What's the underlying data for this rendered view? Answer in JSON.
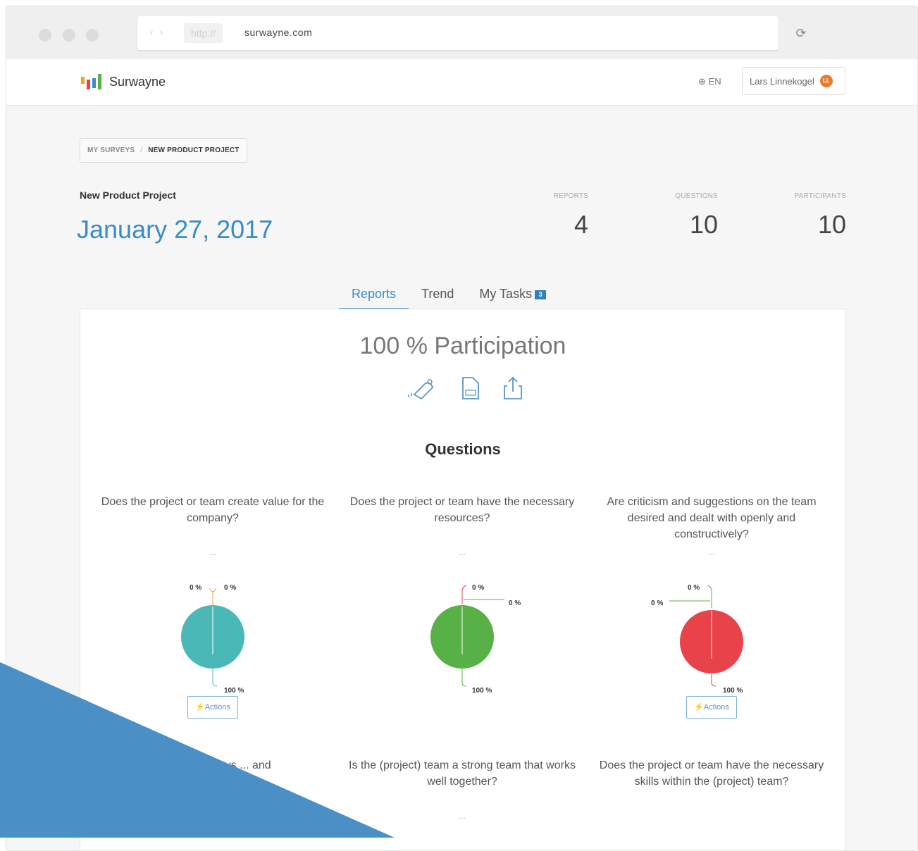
{
  "browser": {
    "url_scheme": "http://",
    "url_host": "surwayne.com",
    "nav_glyphs": "‹ ›",
    "reload_glyph": "⟳"
  },
  "header": {
    "brand": "Surwayne",
    "language": "EN",
    "user_name": "Lars Linnekogel",
    "user_initials": "LL"
  },
  "breadcrumb": {
    "root": "MY SURVEYS",
    "separator": "/",
    "current": "NEW PRODUCT PROJECT"
  },
  "project": {
    "name": "New Product Project",
    "date": "January 27, 2017"
  },
  "stats": [
    {
      "label": "REPORTS",
      "value": "4"
    },
    {
      "label": "QUESTIONS",
      "value": "10"
    },
    {
      "label": "PARTICIPANTS",
      "value": "10"
    }
  ],
  "tabs": [
    {
      "label": "Reports",
      "active": true
    },
    {
      "label": "Trend",
      "active": false
    },
    {
      "label": "My Tasks",
      "active": false,
      "badge": "3"
    }
  ],
  "report": {
    "participation": "100 % Participation",
    "icons": [
      "notify-bell-icon",
      "pdf-file-icon",
      "share-icon"
    ],
    "questions_title": "Questions"
  },
  "questions": [
    {
      "text": "Does the project or team create value for the company?",
      "ellipsis": "...",
      "color": "#4bb8b8",
      "slices": [
        {
          "label": "0 %"
        },
        {
          "label": "0 %"
        },
        {
          "label": "100 %"
        }
      ],
      "actions_label": "⚡Actions"
    },
    {
      "text": "Does the project or team have the necessary resources?",
      "ellipsis": "...",
      "color": "#57b146",
      "slices": [
        {
          "label": "0 %"
        },
        {
          "label": "0 %"
        },
        {
          "label": "100 %"
        }
      ],
      "actions_label": ""
    },
    {
      "text": "Are criticism and suggestions on the team desired and dealt with openly and constructively?",
      "ellipsis": "...",
      "color": "#e8434a",
      "slices": [
        {
          "label": "0 %"
        },
        {
          "label": "0 %"
        },
        {
          "label": "100 %"
        }
      ],
      "actions_label": "⚡Actions"
    }
  ],
  "questions_row2": [
    {
      "text": "manager always ... and"
    },
    {
      "text": "Is the (project) team a strong team that works well together?",
      "ellipsis": "..."
    },
    {
      "text": "Does the project or team have the necessary skills within the (project) team?"
    }
  ],
  "colors": {
    "accent": "#3a8cc4",
    "corner_shape": "#4a8fc6",
    "avatar": "#e77c31"
  }
}
